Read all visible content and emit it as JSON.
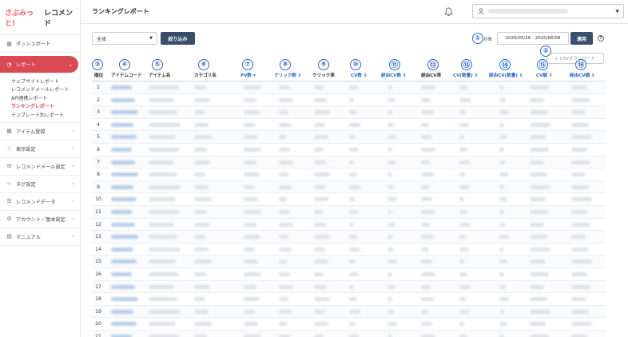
{
  "sidebar": {
    "logo": {
      "part1": "さぶみっと!",
      "part2": "レコメンド"
    },
    "items": [
      {
        "label": "ダッシュボード",
        "icon": "grid-icon"
      },
      {
        "label": "レポート",
        "icon": "chart-icon"
      },
      {
        "label": "アイテム登録",
        "icon": "grid-icon"
      },
      {
        "label": "表示設定",
        "icon": "star-icon"
      },
      {
        "label": "レコメンドメール設定",
        "icon": "mail-icon"
      },
      {
        "label": "タグ設定",
        "icon": "code-icon"
      },
      {
        "label": "レコメンドデータ",
        "icon": "list-icon"
      },
      {
        "label": "アカウント／基本設定",
        "icon": "gear-icon"
      },
      {
        "label": "マニュアル",
        "icon": "book-icon"
      }
    ],
    "report_sub": [
      "ウェブサイトレポート",
      "レコメンドメールレポート",
      "API連携レポート",
      "ランキングレポート",
      "テンプレート別レポート"
    ]
  },
  "header": {
    "title": "ランキングレポート"
  },
  "filter": {
    "selected": "全体",
    "filter_button": "絞り込み"
  },
  "period": {
    "label": "対象",
    "value": "2020/05/26 - 2020/06/08",
    "apply_button": "適用"
  },
  "csv_button": "CSVダウンロード",
  "callouts": [
    "①",
    "②",
    "③",
    "④",
    "⑤",
    "⑥",
    "⑦",
    "⑧",
    "⑨",
    "⑩",
    "⑪",
    "⑫",
    "⑬",
    "⑭",
    "⑮",
    "⑯"
  ],
  "table": {
    "columns": [
      "順位",
      "アイテムコード",
      "アイテム名",
      "カテゴリ名",
      "PV数 ▾",
      "クリック数 ⇕",
      "クリック率",
      "CV数 ⇕",
      "経由CV数 ⇕",
      "経由CV率",
      "CV(数量) ⇕",
      "経由CV(数量) ⇕",
      "CV額 ⇕",
      "経由CV額 ⇕"
    ],
    "ranks": [
      "1",
      "2",
      "3",
      "4",
      "5",
      "6",
      "7",
      "8",
      "9",
      "10",
      "11",
      "12",
      "13",
      "14",
      "15",
      "16",
      "17",
      "18",
      "19",
      "20",
      "21"
    ]
  },
  "colors": {
    "accent": "#d94a55",
    "primary": "#3b4f6b",
    "link": "#2b6bc4"
  }
}
